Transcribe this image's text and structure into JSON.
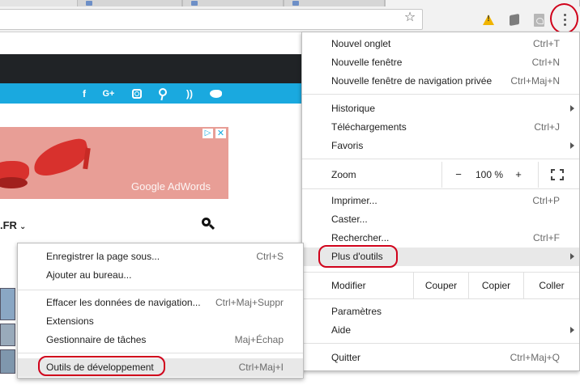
{
  "browser": {
    "icons": [
      "star-icon",
      "warning-extension-icon",
      "cube-extension-icon",
      "pdf-extension-icon",
      "kebab-menu-icon"
    ]
  },
  "website": {
    "social_icons": [
      "facebook-icon",
      "google-plus-icon",
      "instagram-icon",
      "pinterest-icon",
      "rss-icon",
      "twitter-icon"
    ],
    "social_labels": {
      "fb": "f",
      "gp": "G+",
      "rss": "))"
    },
    "ad": {
      "brand": "Google AdWords",
      "choices": "▷",
      "close": "✕"
    },
    "nav_label": ".FR",
    "nav_chevron": "⌄"
  },
  "menu": {
    "group1": [
      {
        "label": "Nouvel onglet",
        "shortcut": "Ctrl+T"
      },
      {
        "label": "Nouvelle fenêtre",
        "shortcut": "Ctrl+N"
      },
      {
        "label": "Nouvelle fenêtre de navigation privée",
        "shortcut": "Ctrl+Maj+N"
      }
    ],
    "group2": [
      {
        "label": "Historique",
        "shortcut": "",
        "submenu": true
      },
      {
        "label": "Téléchargements",
        "shortcut": "Ctrl+J"
      },
      {
        "label": "Favoris",
        "shortcut": "",
        "submenu": true
      }
    ],
    "zoom": {
      "label": "Zoom",
      "minus": "−",
      "value": "100 %",
      "plus": "+"
    },
    "group3": [
      {
        "label": "Imprimer...",
        "shortcut": "Ctrl+P"
      },
      {
        "label": "Caster...",
        "shortcut": ""
      },
      {
        "label": "Rechercher...",
        "shortcut": "Ctrl+F"
      },
      {
        "label": "Plus d'outils",
        "shortcut": "",
        "submenu": true,
        "highlighted": true
      }
    ],
    "edit": {
      "label": "Modifier",
      "cut": "Couper",
      "copy": "Copier",
      "paste": "Coller"
    },
    "group4": [
      {
        "label": "Paramètres",
        "shortcut": ""
      },
      {
        "label": "Aide",
        "shortcut": "",
        "submenu": true
      }
    ],
    "quit": {
      "label": "Quitter",
      "shortcut": "Ctrl+Maj+Q"
    }
  },
  "submenu": {
    "group1": [
      {
        "label": "Enregistrer la page sous...",
        "shortcut": "Ctrl+S"
      },
      {
        "label": "Ajouter au bureau...",
        "shortcut": ""
      }
    ],
    "group2": [
      {
        "label": "Effacer les données de navigation...",
        "shortcut": "Ctrl+Maj+Suppr"
      },
      {
        "label": "Extensions",
        "shortcut": ""
      },
      {
        "label": "Gestionnaire de tâches",
        "shortcut": "Maj+Échap"
      }
    ],
    "group3": [
      {
        "label": "Outils de développement",
        "shortcut": "Ctrl+Maj+I",
        "highlighted": true
      }
    ]
  },
  "annotation_color": "#d0021b",
  "accent_social_bar": "#1aa9df"
}
